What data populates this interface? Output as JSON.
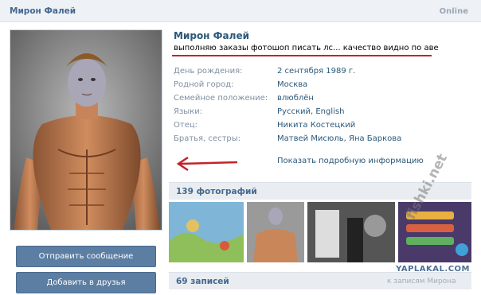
{
  "header": {
    "name": "Мирон Фалей",
    "status": "Online"
  },
  "profile": {
    "name": "Мирон Фалей",
    "status_text": "выполняю заказы фотошоп писать лс... качество видно по аве",
    "info": [
      {
        "label": "День рождения:",
        "value": "2 сентября 1989 г."
      },
      {
        "label": "Родной город:",
        "value": "Москва"
      },
      {
        "label": "Семейное положение:",
        "value": "влюблён"
      },
      {
        "label": "Языки:",
        "value": "Русский, English"
      },
      {
        "label": "Отец:",
        "value": "Никита Костецкий"
      },
      {
        "label": "Братья, сестры:",
        "value": "Матвей Мисюль, Яна Баркова"
      }
    ],
    "more_link": "Показать подробную информацию"
  },
  "buttons": {
    "send_message": "Отправить сообщение",
    "add_friend": "Добавить в друзья"
  },
  "photos": {
    "title": "139 фотографий"
  },
  "posts": {
    "title": "69 записей",
    "wall_link": "к записям Мирона"
  },
  "watermarks": {
    "diagonal": "fishki.net",
    "site": "YAPLAKAL.COM"
  },
  "colors": {
    "link": "#2b587a",
    "header_bg": "#eef1f5",
    "button": "#5c7ea3",
    "underline": "#c4222a"
  }
}
